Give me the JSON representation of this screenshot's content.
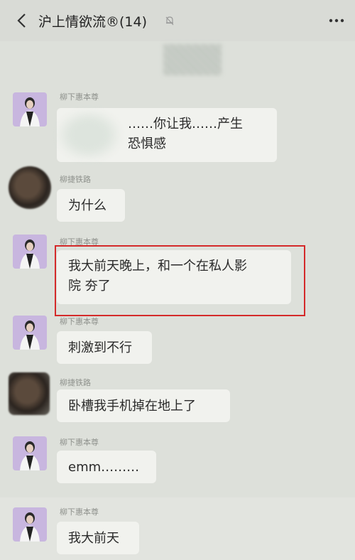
{
  "header": {
    "title": "沪上情欲流®(14)"
  },
  "messages": [
    {
      "sender": "柳下惠本尊",
      "text": "……你让我……产生恐惧感",
      "line1": "……你让我……产生",
      "line2": "恐惧感"
    },
    {
      "sender": "柳捷铁路",
      "text": "为什么"
    },
    {
      "sender": "柳下惠本尊",
      "line1": "我大前天晚上，和一个在私人影",
      "line2": "院 夯了"
    },
    {
      "sender": "柳下惠本尊",
      "text": "刺激到不行"
    },
    {
      "sender": "柳捷铁路",
      "text": "卧槽我手机掉在地上了"
    },
    {
      "sender": "柳下惠本尊",
      "text": "emm………"
    },
    {
      "sender": "柳下惠本尊",
      "text": "我大前天"
    }
  ],
  "highlight_color": "#d42a2a"
}
